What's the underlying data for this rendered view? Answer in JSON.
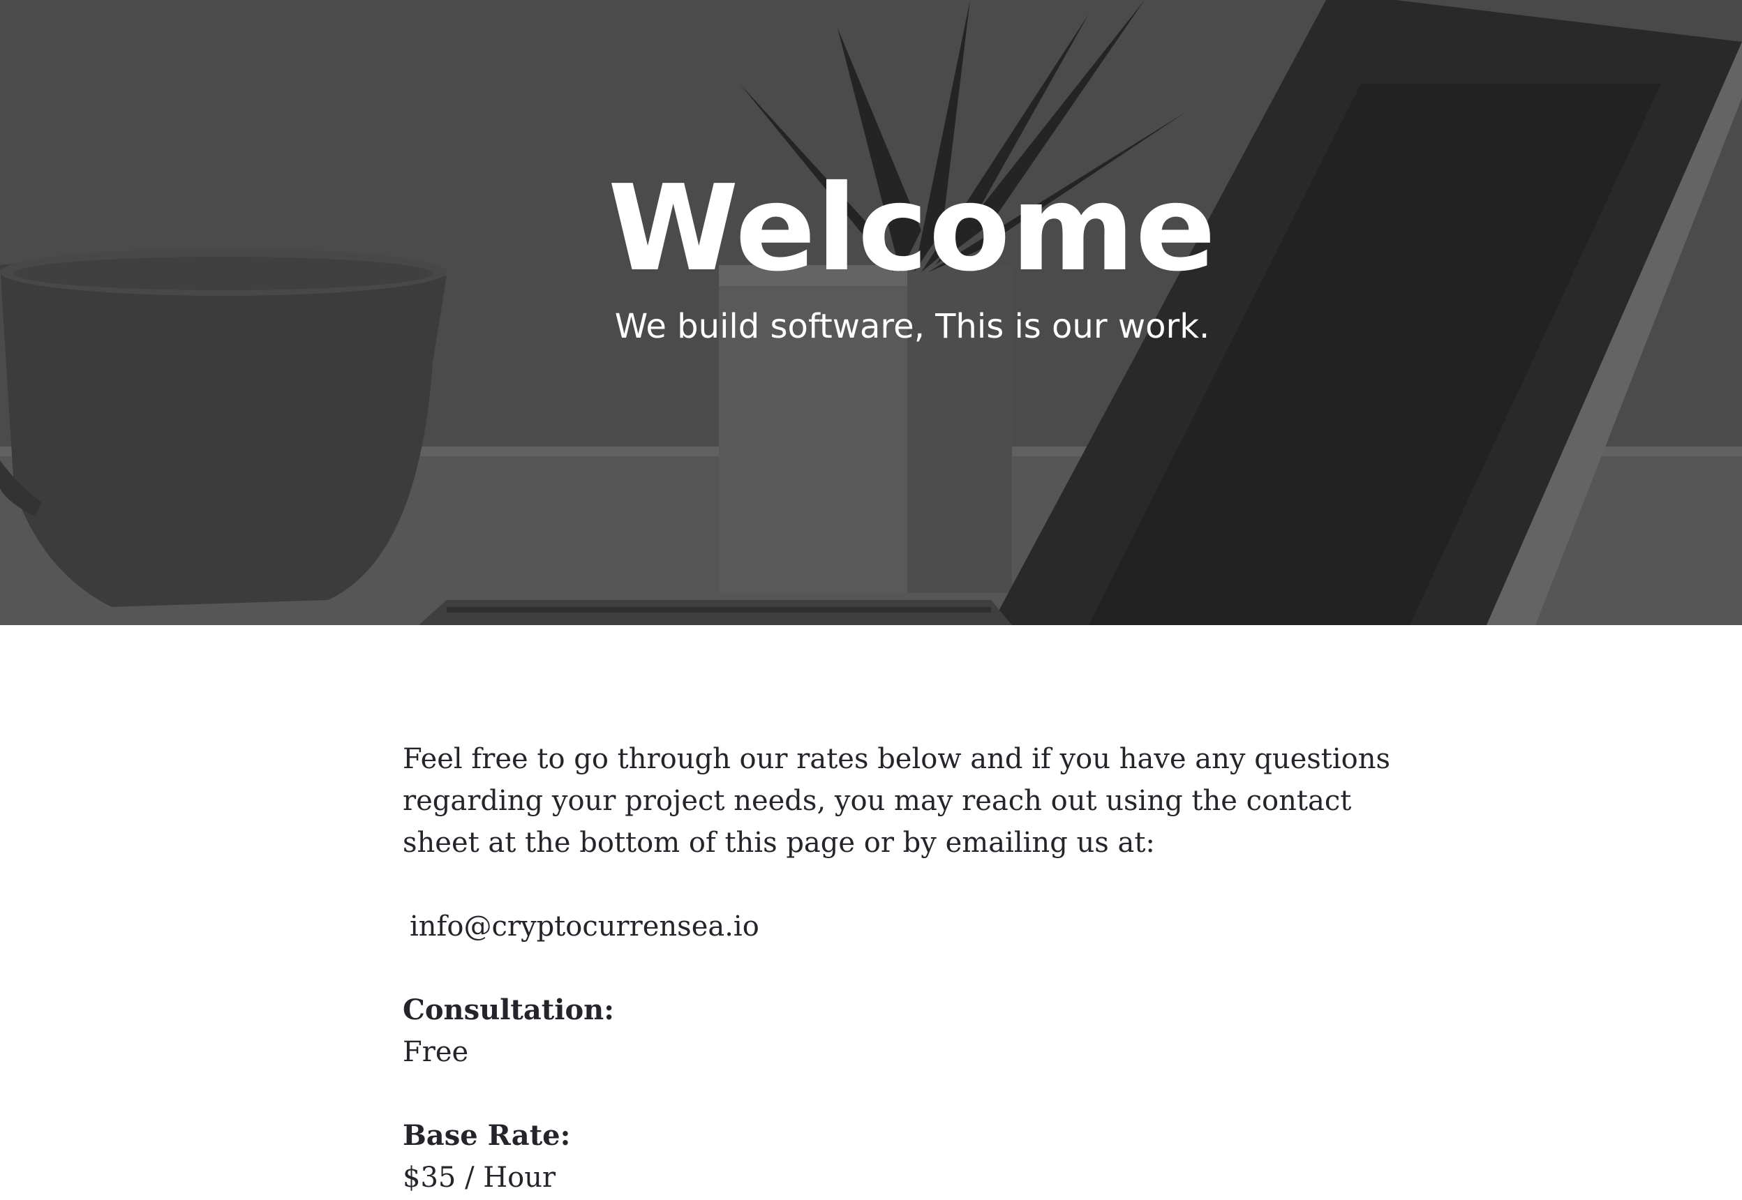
{
  "hero": {
    "title": "Welcome",
    "subtitle": "We build software, This is our work."
  },
  "content": {
    "intro": "Feel free to go through our rates below and if you have any questions regarding your project needs, you may reach out using the contact sheet at the bottom of this page or by emailing us  at:",
    "email": "info@cryptocurrensea.io",
    "rates": [
      {
        "label": "Consultation:",
        "value": "Free"
      },
      {
        "label": "Base Rate:",
        "value": "$35 / Hour"
      }
    ]
  },
  "colors": {
    "hero_overlay": "#555555",
    "text": "#24252b",
    "hero_text": "#ffffff",
    "background": "#ffffff"
  }
}
